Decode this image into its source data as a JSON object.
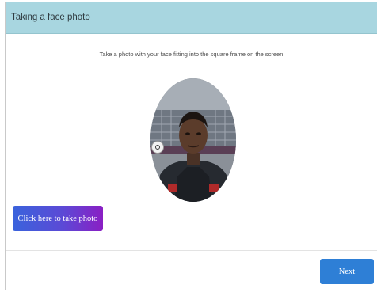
{
  "header": {
    "title": "Taking a face photo"
  },
  "main": {
    "instruction": "Take a photo with your face fitting into the square frame on the screen",
    "take_photo_label": "Click here to take photo"
  },
  "footer": {
    "next_label": "Next"
  },
  "icons": {
    "capture": "camera-icon"
  },
  "colors": {
    "header_bg": "#a8d6e0",
    "take_photo_gradient_start": "#3a63dc",
    "take_photo_gradient_end": "#8a1fc4",
    "next_button": "#2e7fd6"
  }
}
